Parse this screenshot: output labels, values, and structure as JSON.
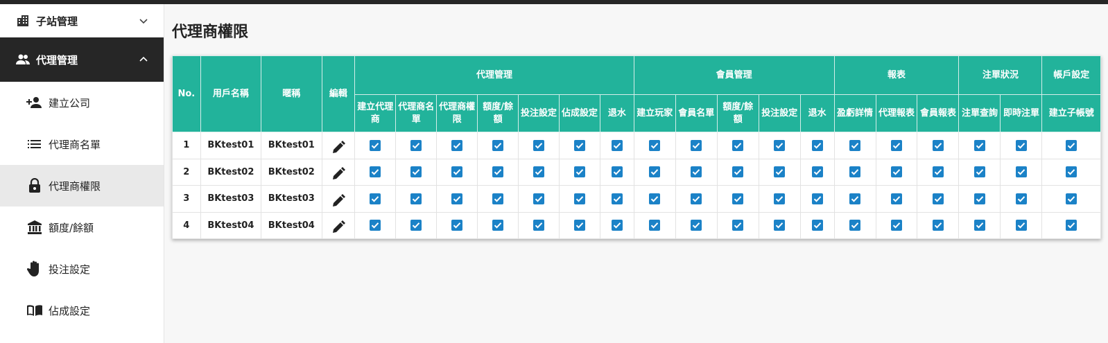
{
  "sidebar": {
    "groups": [
      {
        "label": "子站管理",
        "icon": "building-icon",
        "expanded": false
      },
      {
        "label": "代理管理",
        "icon": "people-icon",
        "expanded": true
      }
    ],
    "items": [
      {
        "label": "建立公司",
        "icon": "person-add-icon"
      },
      {
        "label": "代理商名單",
        "icon": "list-icon"
      },
      {
        "label": "代理商權限",
        "icon": "lock-icon",
        "active": true
      },
      {
        "label": "額度/餘額",
        "icon": "bank-icon"
      },
      {
        "label": "投注設定",
        "icon": "hand-icon"
      },
      {
        "label": "佔成設定",
        "icon": "book-icon"
      }
    ]
  },
  "main": {
    "title": "代理商權限",
    "table": {
      "fixed_headers": [
        "No.",
        "用戶名稱",
        "暱稱",
        "編輯"
      ],
      "groups": [
        {
          "label": "代理管理",
          "cols": [
            "建立代理商",
            "代理商名單",
            "代理商權限",
            "額度/餘額",
            "投注設定",
            "佔成設定",
            "退水"
          ]
        },
        {
          "label": "會員管理",
          "cols": [
            "建立玩家",
            "會員名單",
            "額度/餘額",
            "投注設定",
            "退水"
          ]
        },
        {
          "label": "報表",
          "cols": [
            "盈虧詳情",
            "代理報表",
            "會員報表"
          ]
        },
        {
          "label": "注單狀況",
          "cols": [
            "注單查詢",
            "即時注單"
          ]
        },
        {
          "label": "帳戶設定",
          "cols": [
            "建立子帳號"
          ]
        }
      ],
      "rows": [
        {
          "no": "1",
          "username": "BKtest01",
          "nickname": "BKtest01"
        },
        {
          "no": "2",
          "username": "BKtest02",
          "nickname": "BKtest02"
        },
        {
          "no": "3",
          "username": "BKtest03",
          "nickname": "BKtest03"
        },
        {
          "no": "4",
          "username": "BKtest04",
          "nickname": "BKtest04"
        }
      ]
    }
  },
  "colors": {
    "header": "#22b39b",
    "checkbox": "#1b82c7",
    "active_group": "#262626"
  }
}
